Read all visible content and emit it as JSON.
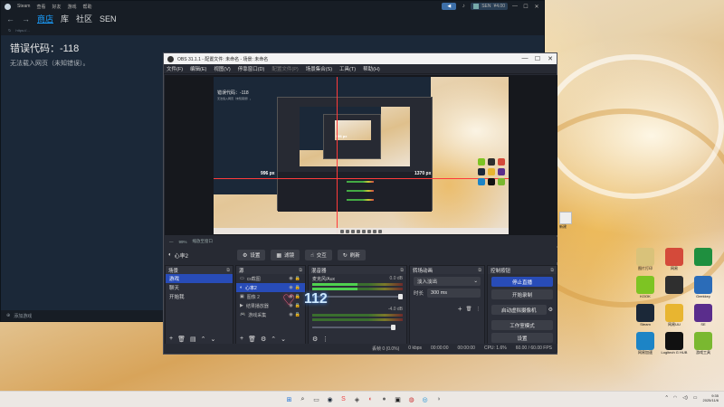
{
  "steam": {
    "title_menus": [
      "Steam",
      "查看",
      "好友",
      "游戏",
      "帮助"
    ],
    "notify_label": "",
    "user_name": "SEN",
    "user_balance": "¥4.00",
    "nav": [
      "商店",
      "库",
      "社区",
      "SEN"
    ],
    "url": "https://...",
    "error_title": "错误代码：-118",
    "error_message": "无法载入网页（未知错误）。",
    "bottom_bar": "添加游戏"
  },
  "obs": {
    "title": "OBS 31.1.1 - 配置文件: 未命名 - 场景: 未命名",
    "menu": [
      "文件(F)",
      "编辑(E)",
      "视图(V)",
      "停靠窗口(D)",
      "配置文件(P)",
      "场景集合(S)",
      "工具(T)",
      "帮助(H)"
    ],
    "preview": {
      "nested_error": "错误代码：-118",
      "px_label_left": "996 px",
      "px_label_right": "1370 px",
      "px_label_top": "996 px"
    },
    "zoom": "99%",
    "zoom_mode": "缩放至窗口",
    "current_source": "心率2",
    "toolbar": {
      "settings": "设置",
      "filters": "滤镜",
      "interact": "交互",
      "refresh": "刷新"
    },
    "scenes": {
      "header": "场景",
      "items": [
        "游戏",
        "聊天",
        "开始我"
      ],
      "selected": 0
    },
    "sources": {
      "header": "源",
      "items": [
        "cs截图",
        "心率2",
        "图像 2",
        "结果播放器",
        "游戏采集"
      ],
      "selected": 1
    },
    "mixer": {
      "header": "混音器",
      "channels": [
        {
          "name": "麦克风/Aux",
          "db": "0.0 dB"
        },
        {
          "name": "",
          "db": "-4.0 dB"
        }
      ]
    },
    "transitions": {
      "header": "转场动画",
      "type": "淡入淡出",
      "duration_label": "时长",
      "duration_value": "300 ms"
    },
    "controls": {
      "header": "控制按钮",
      "stop_stream": "停止直播",
      "start_record": "开始录制",
      "virtual_cam": "启动虚拟摄像机",
      "studio_mode": "工作室模式",
      "settings": "设置"
    },
    "status": {
      "dropped": "丢帧 0 (0.0%)",
      "bitrate": "0 kbps",
      "stream_time": "00:00:00",
      "rec_time": "00:00:00",
      "cpu": "CPU: 1.6%",
      "fps": "60.00 / 60.00 FPS"
    }
  },
  "overlay": {
    "heart": "♡",
    "heart_rate": "112"
  },
  "desktop_icons": [
    {
      "label": "图片打印",
      "color": "#d9c27a"
    },
    {
      "label": "网易",
      "color": "#d44a3a"
    },
    {
      "label": "",
      "color": "#1f8f3f"
    },
    {
      "label": "KOOK",
      "color": "#7dc423"
    },
    {
      "label": "",
      "color": "#2f2f2f"
    },
    {
      "label": "Geekkey",
      "color": "#2b6cb8"
    },
    {
      "label": "Steam",
      "color": "#1b2838"
    },
    {
      "label": "网易UU",
      "color": "#e8b530"
    },
    {
      "label": "SE",
      "color": "#5a2d8c"
    },
    {
      "label": "网易加速",
      "color": "#1c84c6"
    },
    {
      "label": "Logitech G HUB",
      "color": "#111111"
    },
    {
      "label": "游戏工具",
      "color": "#7ab830"
    }
  ],
  "mini_right_label": "新建",
  "taskbar": {
    "icons": [
      "⊞",
      "⌕",
      "▭",
      "◉",
      "S",
      "◈",
      "◐",
      "●",
      "▣",
      "◍",
      "◎",
      "◑"
    ],
    "time": "9:35",
    "date": "2025/11/6"
  }
}
